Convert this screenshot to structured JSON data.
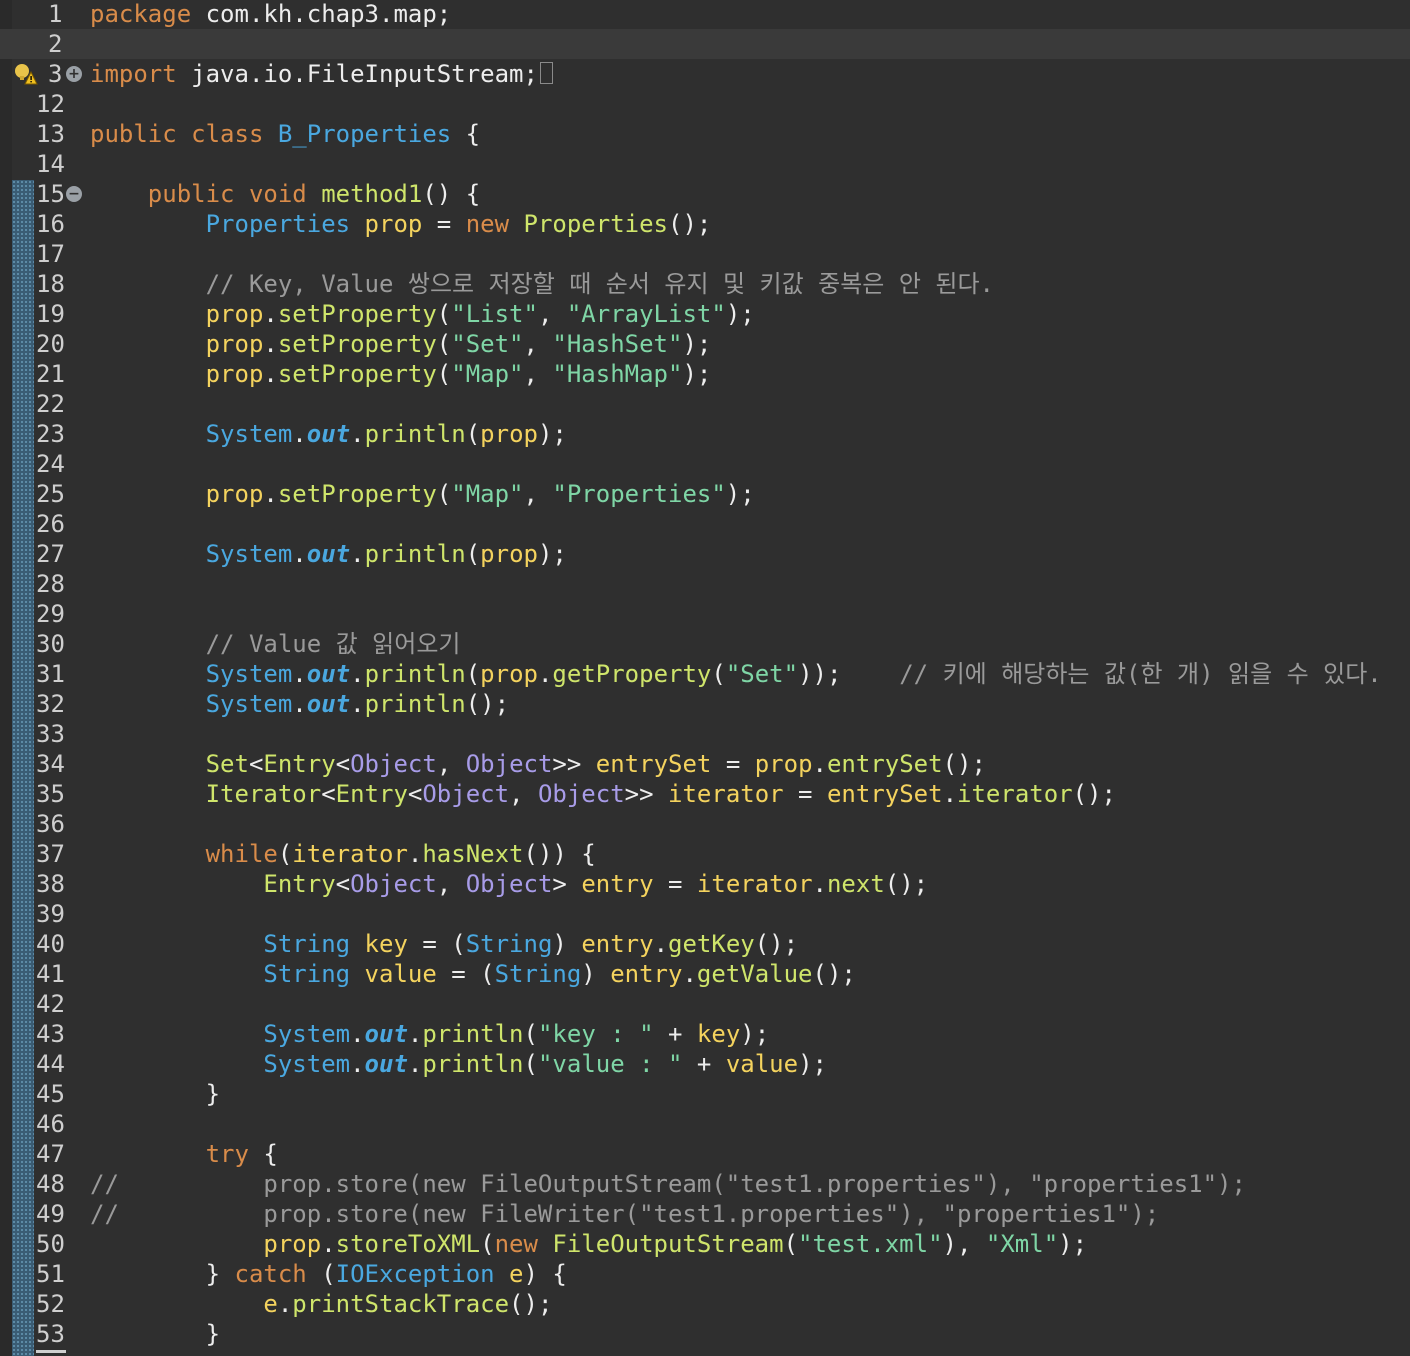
{
  "editor": {
    "warning_marker": "warning-icon",
    "lines": [
      {
        "n": "1",
        "t": [
          [
            "kw",
            "package"
          ],
          [
            "p",
            " com.kh.chap3.map;"
          ]
        ]
      },
      {
        "n": "2",
        "t": [
          [
            "p",
            ""
          ]
        ],
        "current": true
      },
      {
        "n": "3",
        "fold": "+",
        "warn": true,
        "foldbox": true,
        "t": [
          [
            "kw",
            "import"
          ],
          [
            "p",
            " java.io.FileInputStream;"
          ]
        ]
      },
      {
        "n": "12",
        "t": [
          [
            "p",
            ""
          ]
        ]
      },
      {
        "n": "13",
        "t": [
          [
            "kw",
            "public class "
          ],
          [
            "ty",
            "B_Properties"
          ],
          [
            "p",
            " {"
          ]
        ]
      },
      {
        "n": "14",
        "t": [
          [
            "p",
            ""
          ]
        ]
      },
      {
        "n": "15",
        "fold": "−",
        "t": [
          [
            "p",
            "    "
          ],
          [
            "kw",
            "public void "
          ],
          [
            "fn",
            "method1"
          ],
          [
            "p",
            "() {"
          ]
        ]
      },
      {
        "n": "16",
        "t": [
          [
            "p",
            "        "
          ],
          [
            "ty",
            "Properties "
          ],
          [
            "var",
            "prop"
          ],
          [
            "p",
            " = "
          ],
          [
            "kw",
            "new "
          ],
          [
            "fn",
            "Properties"
          ],
          [
            "p",
            "();"
          ]
        ]
      },
      {
        "n": "17",
        "t": [
          [
            "p",
            ""
          ]
        ]
      },
      {
        "n": "18",
        "t": [
          [
            "p",
            "        "
          ],
          [
            "cm",
            "// Key, Value 쌍으로 저장할 때 순서 유지 및 키값 중복은 안 된다."
          ]
        ]
      },
      {
        "n": "19",
        "t": [
          [
            "p",
            "        "
          ],
          [
            "var",
            "prop"
          ],
          [
            "p",
            "."
          ],
          [
            "fn",
            "setProperty"
          ],
          [
            "p",
            "("
          ],
          [
            "str",
            "\"List\""
          ],
          [
            "p",
            ", "
          ],
          [
            "str",
            "\"ArrayList\""
          ],
          [
            "p",
            ");"
          ]
        ]
      },
      {
        "n": "20",
        "t": [
          [
            "p",
            "        "
          ],
          [
            "var",
            "prop"
          ],
          [
            "p",
            "."
          ],
          [
            "fn",
            "setProperty"
          ],
          [
            "p",
            "("
          ],
          [
            "str",
            "\"Set\""
          ],
          [
            "p",
            ", "
          ],
          [
            "str",
            "\"HashSet\""
          ],
          [
            "p",
            ");"
          ]
        ]
      },
      {
        "n": "21",
        "t": [
          [
            "p",
            "        "
          ],
          [
            "var",
            "prop"
          ],
          [
            "p",
            "."
          ],
          [
            "fn",
            "setProperty"
          ],
          [
            "p",
            "("
          ],
          [
            "str",
            "\"Map\""
          ],
          [
            "p",
            ", "
          ],
          [
            "str",
            "\"HashMap\""
          ],
          [
            "p",
            ");"
          ]
        ]
      },
      {
        "n": "22",
        "t": [
          [
            "p",
            ""
          ]
        ]
      },
      {
        "n": "23",
        "t": [
          [
            "p",
            "        "
          ],
          [
            "ty",
            "System"
          ],
          [
            "p",
            "."
          ],
          [
            "out",
            "out"
          ],
          [
            "p",
            "."
          ],
          [
            "fn",
            "println"
          ],
          [
            "p",
            "("
          ],
          [
            "var",
            "prop"
          ],
          [
            "p",
            ");"
          ]
        ]
      },
      {
        "n": "24",
        "t": [
          [
            "p",
            ""
          ]
        ]
      },
      {
        "n": "25",
        "t": [
          [
            "p",
            "        "
          ],
          [
            "var",
            "prop"
          ],
          [
            "p",
            "."
          ],
          [
            "fn",
            "setProperty"
          ],
          [
            "p",
            "("
          ],
          [
            "str",
            "\"Map\""
          ],
          [
            "p",
            ", "
          ],
          [
            "str",
            "\"Properties\""
          ],
          [
            "p",
            ");"
          ]
        ]
      },
      {
        "n": "26",
        "t": [
          [
            "p",
            ""
          ]
        ]
      },
      {
        "n": "27",
        "t": [
          [
            "p",
            "        "
          ],
          [
            "ty",
            "System"
          ],
          [
            "p",
            "."
          ],
          [
            "out",
            "out"
          ],
          [
            "p",
            "."
          ],
          [
            "fn",
            "println"
          ],
          [
            "p",
            "("
          ],
          [
            "var",
            "prop"
          ],
          [
            "p",
            ");"
          ]
        ]
      },
      {
        "n": "28",
        "t": [
          [
            "p",
            ""
          ]
        ]
      },
      {
        "n": "29",
        "t": [
          [
            "p",
            ""
          ]
        ]
      },
      {
        "n": "30",
        "t": [
          [
            "p",
            "        "
          ],
          [
            "cm",
            "// Value 값 읽어오기"
          ]
        ]
      },
      {
        "n": "31",
        "t": [
          [
            "p",
            "        "
          ],
          [
            "ty",
            "System"
          ],
          [
            "p",
            "."
          ],
          [
            "out",
            "out"
          ],
          [
            "p",
            "."
          ],
          [
            "fn",
            "println"
          ],
          [
            "p",
            "("
          ],
          [
            "var",
            "prop"
          ],
          [
            "p",
            "."
          ],
          [
            "fn",
            "getProperty"
          ],
          [
            "p",
            "("
          ],
          [
            "str",
            "\"Set\""
          ],
          [
            "p",
            "));    "
          ],
          [
            "cm",
            "// 키에 해당하는 값(한 개) 읽을 수 있다."
          ]
        ]
      },
      {
        "n": "32",
        "t": [
          [
            "p",
            "        "
          ],
          [
            "ty",
            "System"
          ],
          [
            "p",
            "."
          ],
          [
            "out",
            "out"
          ],
          [
            "p",
            "."
          ],
          [
            "fn",
            "println"
          ],
          [
            "p",
            "();"
          ]
        ]
      },
      {
        "n": "33",
        "t": [
          [
            "p",
            ""
          ]
        ]
      },
      {
        "n": "34",
        "t": [
          [
            "p",
            "        "
          ],
          [
            "fn",
            "Set"
          ],
          [
            "p",
            "<"
          ],
          [
            "fn",
            "Entry"
          ],
          [
            "p",
            "<"
          ],
          [
            "cls",
            "Object"
          ],
          [
            "p",
            ", "
          ],
          [
            "cls",
            "Object"
          ],
          [
            "p",
            ">> "
          ],
          [
            "var",
            "entrySet"
          ],
          [
            "p",
            " = "
          ],
          [
            "var",
            "prop"
          ],
          [
            "p",
            "."
          ],
          [
            "fn",
            "entrySet"
          ],
          [
            "p",
            "();"
          ]
        ]
      },
      {
        "n": "35",
        "t": [
          [
            "p",
            "        "
          ],
          [
            "fn",
            "Iterator"
          ],
          [
            "p",
            "<"
          ],
          [
            "fn",
            "Entry"
          ],
          [
            "p",
            "<"
          ],
          [
            "cls",
            "Object"
          ],
          [
            "p",
            ", "
          ],
          [
            "cls",
            "Object"
          ],
          [
            "p",
            ">> "
          ],
          [
            "var",
            "iterator"
          ],
          [
            "p",
            " = "
          ],
          [
            "var",
            "entrySet"
          ],
          [
            "p",
            "."
          ],
          [
            "fn",
            "iterator"
          ],
          [
            "p",
            "();"
          ]
        ]
      },
      {
        "n": "36",
        "t": [
          [
            "p",
            ""
          ]
        ]
      },
      {
        "n": "37",
        "t": [
          [
            "p",
            "        "
          ],
          [
            "kw",
            "while"
          ],
          [
            "p",
            "("
          ],
          [
            "var",
            "iterator"
          ],
          [
            "p",
            "."
          ],
          [
            "fn",
            "hasNext"
          ],
          [
            "p",
            "()) {"
          ]
        ]
      },
      {
        "n": "38",
        "t": [
          [
            "p",
            "            "
          ],
          [
            "fn",
            "Entry"
          ],
          [
            "p",
            "<"
          ],
          [
            "cls",
            "Object"
          ],
          [
            "p",
            ", "
          ],
          [
            "cls",
            "Object"
          ],
          [
            "p",
            "> "
          ],
          [
            "var",
            "entry"
          ],
          [
            "p",
            " = "
          ],
          [
            "var",
            "iterator"
          ],
          [
            "p",
            "."
          ],
          [
            "fn",
            "next"
          ],
          [
            "p",
            "();"
          ]
        ]
      },
      {
        "n": "39",
        "t": [
          [
            "p",
            ""
          ]
        ]
      },
      {
        "n": "40",
        "t": [
          [
            "p",
            "            "
          ],
          [
            "ty",
            "String "
          ],
          [
            "var",
            "key"
          ],
          [
            "p",
            " = ("
          ],
          [
            "ty",
            "String"
          ],
          [
            "p",
            ") "
          ],
          [
            "var",
            "entry"
          ],
          [
            "p",
            "."
          ],
          [
            "fn",
            "getKey"
          ],
          [
            "p",
            "();"
          ]
        ]
      },
      {
        "n": "41",
        "t": [
          [
            "p",
            "            "
          ],
          [
            "ty",
            "String "
          ],
          [
            "var",
            "value"
          ],
          [
            "p",
            " = ("
          ],
          [
            "ty",
            "String"
          ],
          [
            "p",
            ") "
          ],
          [
            "var",
            "entry"
          ],
          [
            "p",
            "."
          ],
          [
            "fn",
            "getValue"
          ],
          [
            "p",
            "();"
          ]
        ]
      },
      {
        "n": "42",
        "t": [
          [
            "p",
            ""
          ]
        ]
      },
      {
        "n": "43",
        "t": [
          [
            "p",
            "            "
          ],
          [
            "ty",
            "System"
          ],
          [
            "p",
            "."
          ],
          [
            "out",
            "out"
          ],
          [
            "p",
            "."
          ],
          [
            "fn",
            "println"
          ],
          [
            "p",
            "("
          ],
          [
            "str",
            "\"key : \""
          ],
          [
            "p",
            " + "
          ],
          [
            "var",
            "key"
          ],
          [
            "p",
            ");"
          ]
        ]
      },
      {
        "n": "44",
        "t": [
          [
            "p",
            "            "
          ],
          [
            "ty",
            "System"
          ],
          [
            "p",
            "."
          ],
          [
            "out",
            "out"
          ],
          [
            "p",
            "."
          ],
          [
            "fn",
            "println"
          ],
          [
            "p",
            "("
          ],
          [
            "str",
            "\"value : \""
          ],
          [
            "p",
            " + "
          ],
          [
            "var",
            "value"
          ],
          [
            "p",
            ");"
          ]
        ]
      },
      {
        "n": "45",
        "t": [
          [
            "p",
            "        }"
          ]
        ]
      },
      {
        "n": "46",
        "t": [
          [
            "p",
            ""
          ]
        ]
      },
      {
        "n": "47",
        "t": [
          [
            "p",
            "        "
          ],
          [
            "kw",
            "try"
          ],
          [
            "p",
            " {"
          ]
        ]
      },
      {
        "n": "48",
        "t": [
          [
            "cm",
            "//          prop.store(new FileOutputStream(\"test1.properties\"), \"properties1\");"
          ]
        ]
      },
      {
        "n": "49",
        "t": [
          [
            "cm",
            "//          prop.store(new FileWriter(\"test1.properties\"), \"properties1\");"
          ]
        ]
      },
      {
        "n": "50",
        "t": [
          [
            "p",
            "            "
          ],
          [
            "var",
            "prop"
          ],
          [
            "p",
            "."
          ],
          [
            "fn",
            "storeToXML"
          ],
          [
            "p",
            "("
          ],
          [
            "kw",
            "new "
          ],
          [
            "fn",
            "FileOutputStream"
          ],
          [
            "p",
            "("
          ],
          [
            "str",
            "\"test.xml\""
          ],
          [
            "p",
            "), "
          ],
          [
            "str",
            "\"Xml\""
          ],
          [
            "p",
            ");"
          ]
        ]
      },
      {
        "n": "51",
        "t": [
          [
            "p",
            "        } "
          ],
          [
            "kw",
            "catch"
          ],
          [
            "p",
            " ("
          ],
          [
            "ty",
            "IOException "
          ],
          [
            "var",
            "e"
          ],
          [
            "p",
            ") {"
          ]
        ]
      },
      {
        "n": "52",
        "t": [
          [
            "p",
            "            "
          ],
          [
            "var",
            "e"
          ],
          [
            "p",
            "."
          ],
          [
            "fn",
            "printStackTrace"
          ],
          [
            "p",
            "();"
          ]
        ]
      },
      {
        "n": "53",
        "t": [
          [
            "p",
            "        }"
          ]
        ]
      }
    ]
  }
}
